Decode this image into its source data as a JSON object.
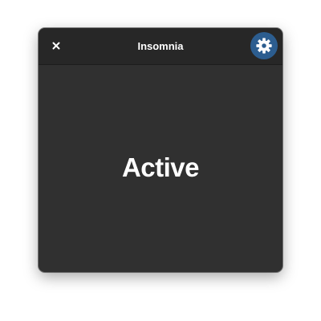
{
  "window": {
    "title": "Insomnia"
  },
  "titlebar": {
    "close_icon": "close-icon",
    "settings_icon": "gear-icon",
    "settings_accent": "#2c5d8f"
  },
  "main": {
    "status": "Active"
  }
}
